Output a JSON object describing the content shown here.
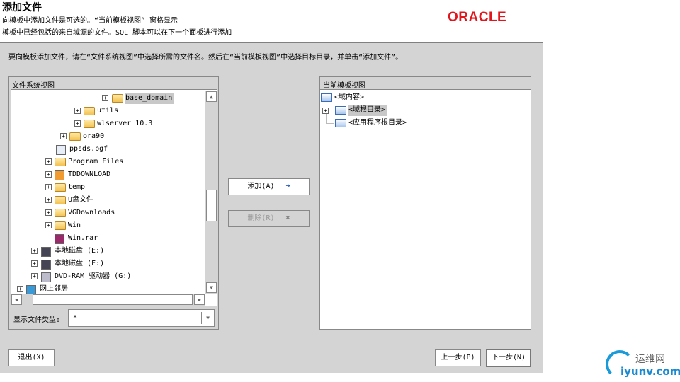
{
  "header": {
    "title": "添加文件",
    "desc1": "向模板中添加文件是可选的。“当前模板视图” 窗格显示",
    "desc2": "模板中已经包括的来自域源的文件。SQL 脚本可以在下一个面板进行添加",
    "logo": "ORACLE"
  },
  "instructions": "要向模板添加文件，请在“文件系统视图”中选择所需的文件名。然后在“当前模板视图”中选择目标目录，并单击“添加文件”。",
  "filesystem": {
    "title": "文件系统视图",
    "items": [
      {
        "label": "base_domain",
        "icon": "folder-icon",
        "selected": true
      },
      {
        "label": "utils",
        "icon": "folder-icon"
      },
      {
        "label": "wlserver_10.3",
        "icon": "folder-icon"
      },
      {
        "label": "ora90",
        "icon": "folder-icon"
      },
      {
        "label": "ppsds.pgf",
        "icon": "file-icon"
      },
      {
        "label": "Program Files",
        "icon": "folder-icon"
      },
      {
        "label": "TDDOWNLOAD",
        "icon": "app-folder-icon"
      },
      {
        "label": "temp",
        "icon": "folder-icon"
      },
      {
        "label": "U盘文件",
        "icon": "folder-icon"
      },
      {
        "label": "VGDownloads",
        "icon": "folder-icon"
      },
      {
        "label": "Win",
        "icon": "folder-icon"
      },
      {
        "label": "Win.rar",
        "icon": "rar-icon"
      },
      {
        "label": "本地磁盘 (E:)",
        "icon": "disk-icon"
      },
      {
        "label": "本地磁盘 (F:)",
        "icon": "disk-icon"
      },
      {
        "label": "DVD-RAM 驱动器 (G:)",
        "icon": "dvd-icon"
      },
      {
        "label": "网上邻居",
        "icon": "network-icon"
      }
    ],
    "filter_label": "显示文件类型:",
    "filter_value": "*"
  },
  "template": {
    "title": "当前模板视图",
    "items": [
      {
        "label": "<域内容>"
      },
      {
        "label": "<域根目录>",
        "selected": true
      },
      {
        "label": "<应用程序根目录>"
      }
    ]
  },
  "buttons": {
    "add": "添加(A)",
    "remove": "删除(R)",
    "exit": "退出(X)",
    "prev": "上一步(P)",
    "next": "下一步(N)"
  },
  "watermark": {
    "cn": "运维网",
    "url": "iyunv.com"
  },
  "colors": {
    "oracle_red": "#e2141c",
    "selection": "#c8c8c8"
  }
}
